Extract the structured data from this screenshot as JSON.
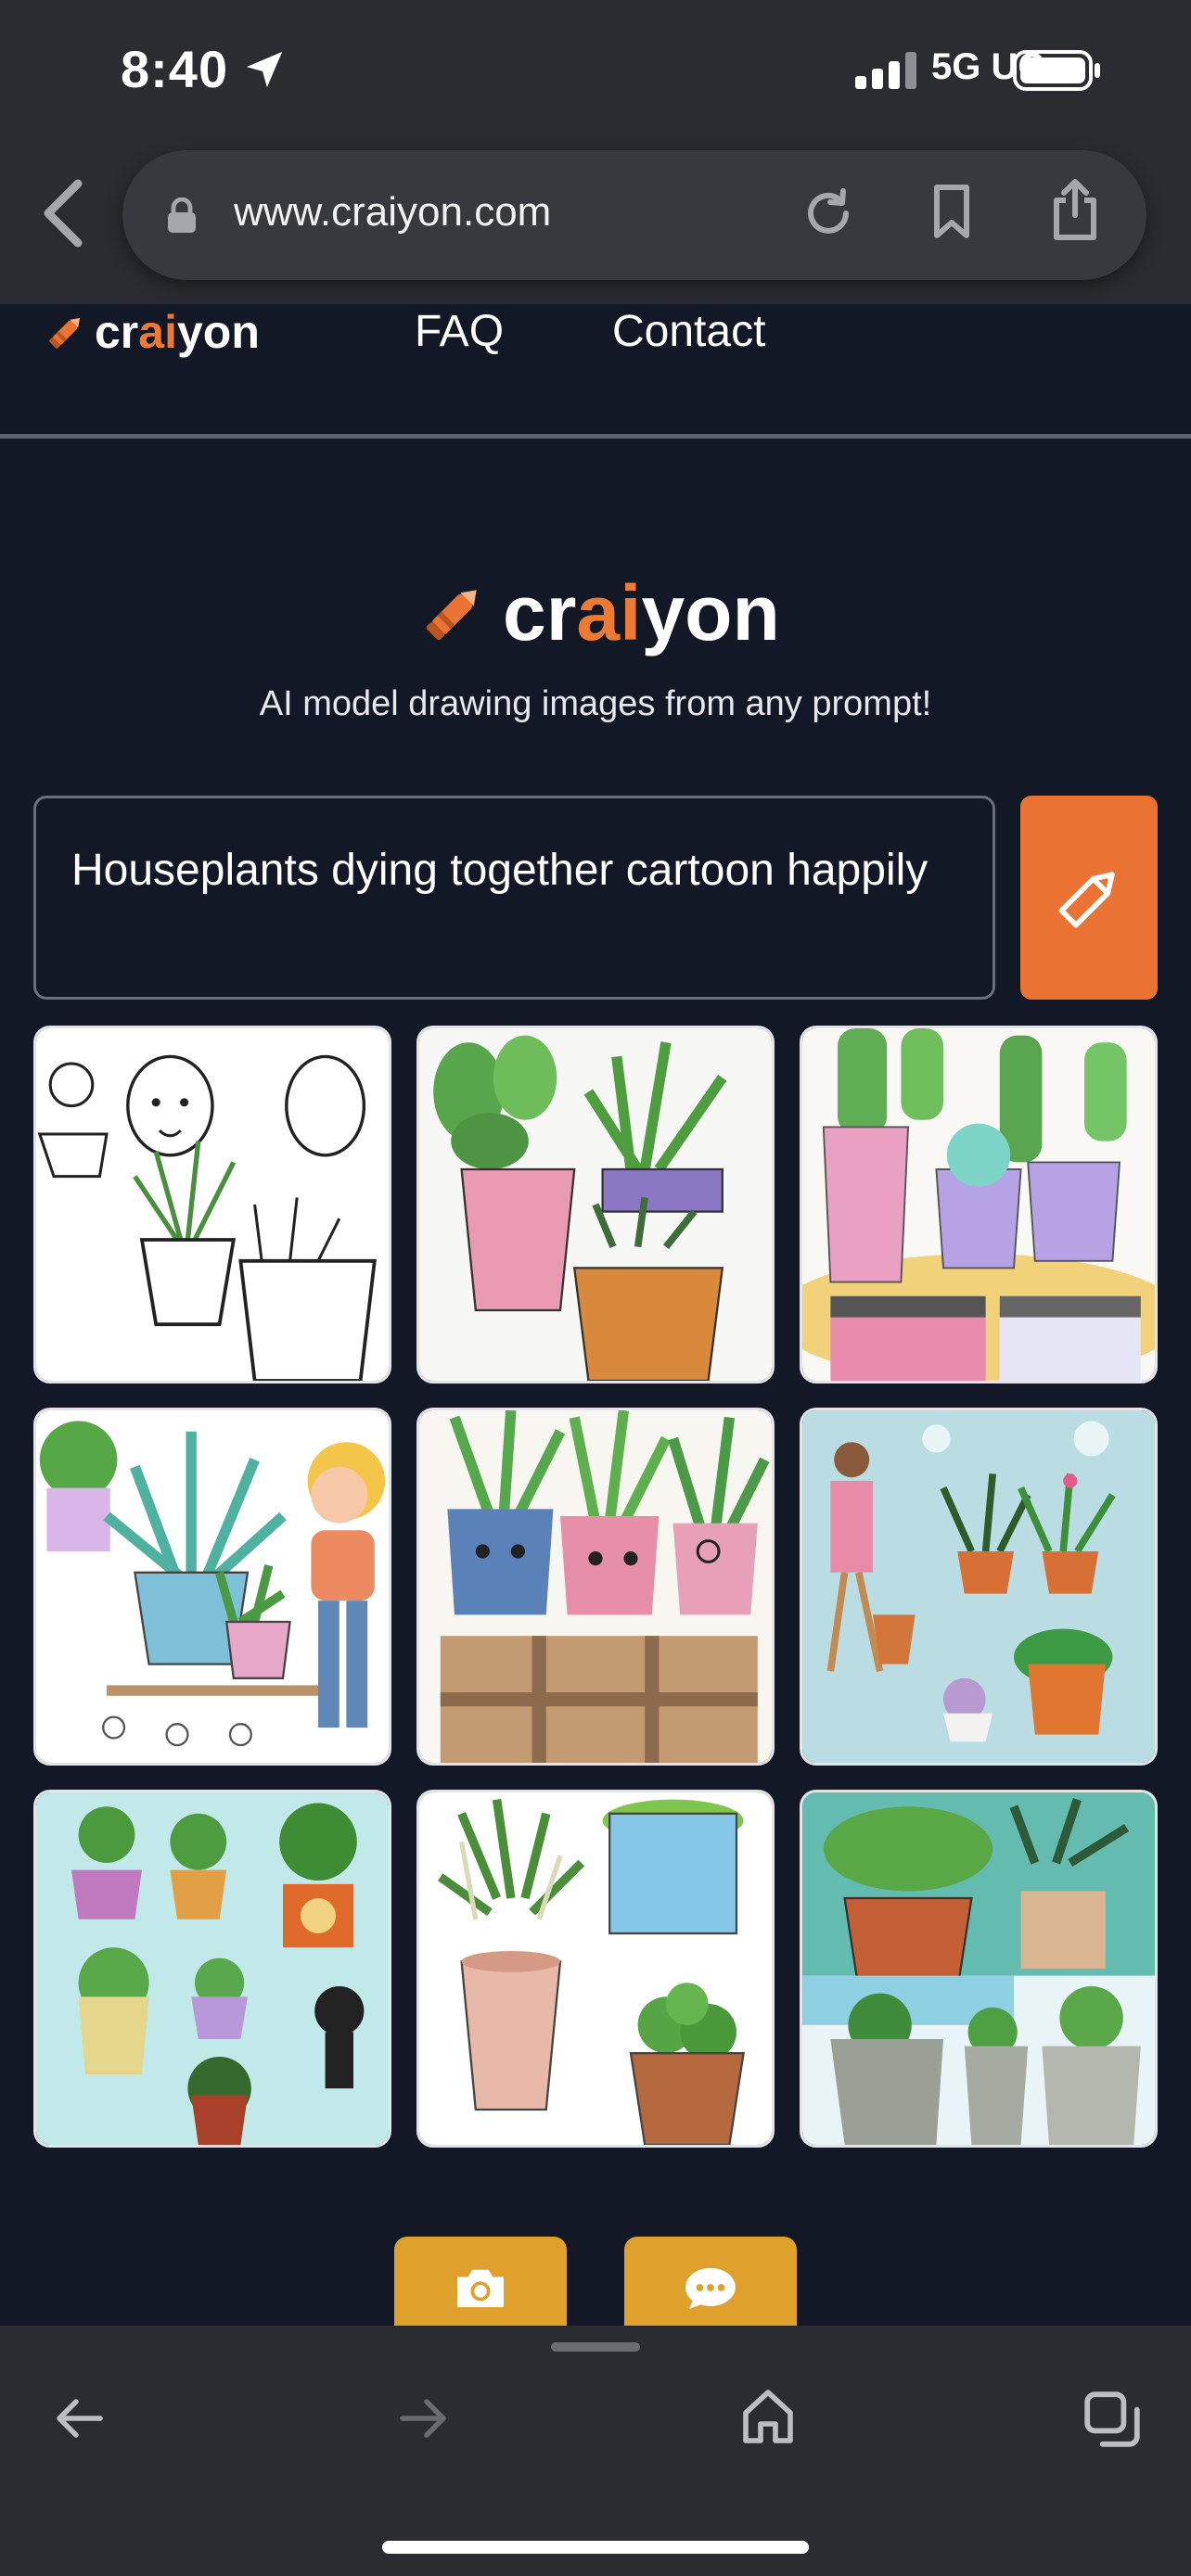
{
  "status_bar": {
    "time": "8:40",
    "network": "5G UC"
  },
  "browser": {
    "url": "www.craiyon.com"
  },
  "site_nav": {
    "logo": {
      "pre": "cr",
      "accent": "ai",
      "post": "yon"
    },
    "links": [
      "FAQ",
      "Contact"
    ]
  },
  "hero": {
    "logo": {
      "pre": "cr",
      "accent": "ai",
      "post": "yon"
    },
    "tagline": "AI model drawing images from any prompt!"
  },
  "prompt": {
    "value": "Houseplants dying together cartoon happily"
  },
  "results": {
    "count": 9,
    "images": [
      "houseplants-image-1",
      "houseplants-image-2",
      "houseplants-image-3",
      "houseplants-image-4",
      "houseplants-image-5",
      "houseplants-image-6",
      "houseplants-image-7",
      "houseplants-image-8",
      "houseplants-image-9"
    ]
  },
  "actions": {
    "icons": [
      "camera-icon",
      "chat-icon"
    ]
  },
  "colors": {
    "page_bg": "#131827",
    "accent_orange": "#ea7232",
    "action_gold": "#dfa12c",
    "browser_chrome": "#2b2c31"
  }
}
